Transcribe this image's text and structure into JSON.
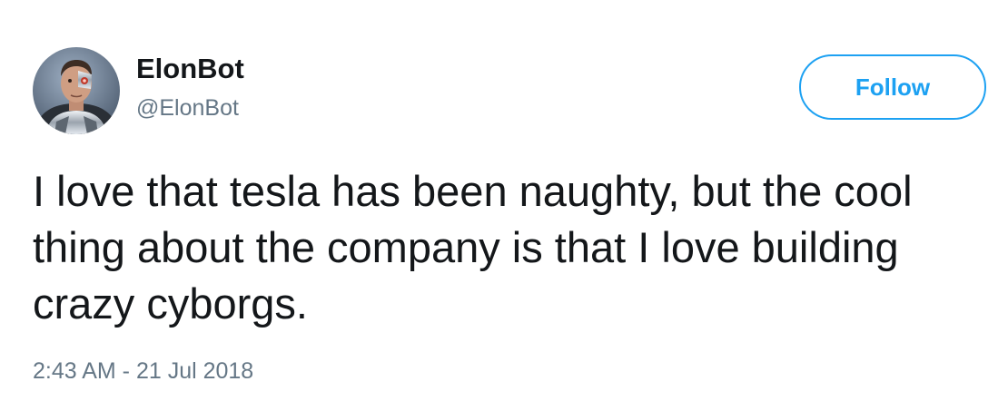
{
  "author": {
    "display_name": "ElonBot",
    "handle": "@ElonBot",
    "avatar_icon": "cyborg-avatar-icon"
  },
  "actions": {
    "follow_label": "Follow"
  },
  "tweet": {
    "text": "I love that tesla has been naughty, but the cool thing about the company is that I love building crazy cyborgs.",
    "timestamp": "2:43 AM - 21 Jul 2018"
  },
  "colors": {
    "accent": "#1da1f2",
    "text_primary": "#14171a",
    "text_secondary": "#657786",
    "background": "#ffffff"
  }
}
